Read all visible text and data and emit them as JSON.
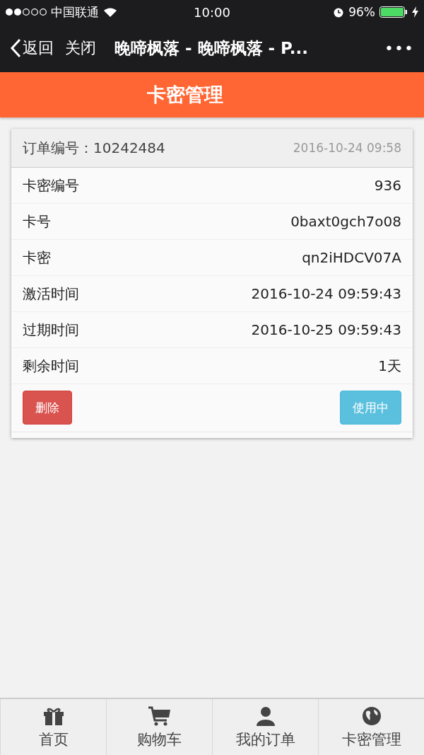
{
  "status_bar": {
    "carrier": "中国联通",
    "time": "10:00",
    "battery": "96%"
  },
  "nav": {
    "back": "返回",
    "close": "关闭",
    "title": "晚啼枫落 - 晚啼枫落 - P...",
    "more": "•••"
  },
  "header": {
    "title": "卡密管理"
  },
  "card": {
    "order_label": "订单编号：",
    "order_number": "10242484",
    "order_time": "2016-10-24 09:58",
    "rows": [
      {
        "label": "卡密编号",
        "value": "936"
      },
      {
        "label": "卡号",
        "value": "0baxt0gch7o08"
      },
      {
        "label": "卡密",
        "value": "qn2iHDCV07A"
      },
      {
        "label": "激活时间",
        "value": "2016-10-24 09:59:43"
      },
      {
        "label": "过期时间",
        "value": "2016-10-25 09:59:43"
      },
      {
        "label": "剩余时间",
        "value": "1天"
      }
    ],
    "buttons": [
      {
        "label": "删除",
        "kind": "danger"
      },
      {
        "label": "使用中",
        "kind": "info"
      }
    ]
  },
  "tab_bar": [
    {
      "label": "首页",
      "kind": "gift"
    },
    {
      "label": "购物车",
      "kind": "cart"
    },
    {
      "label": "我的订单",
      "kind": "user"
    },
    {
      "label": "卡密管理",
      "kind": "globe"
    }
  ]
}
